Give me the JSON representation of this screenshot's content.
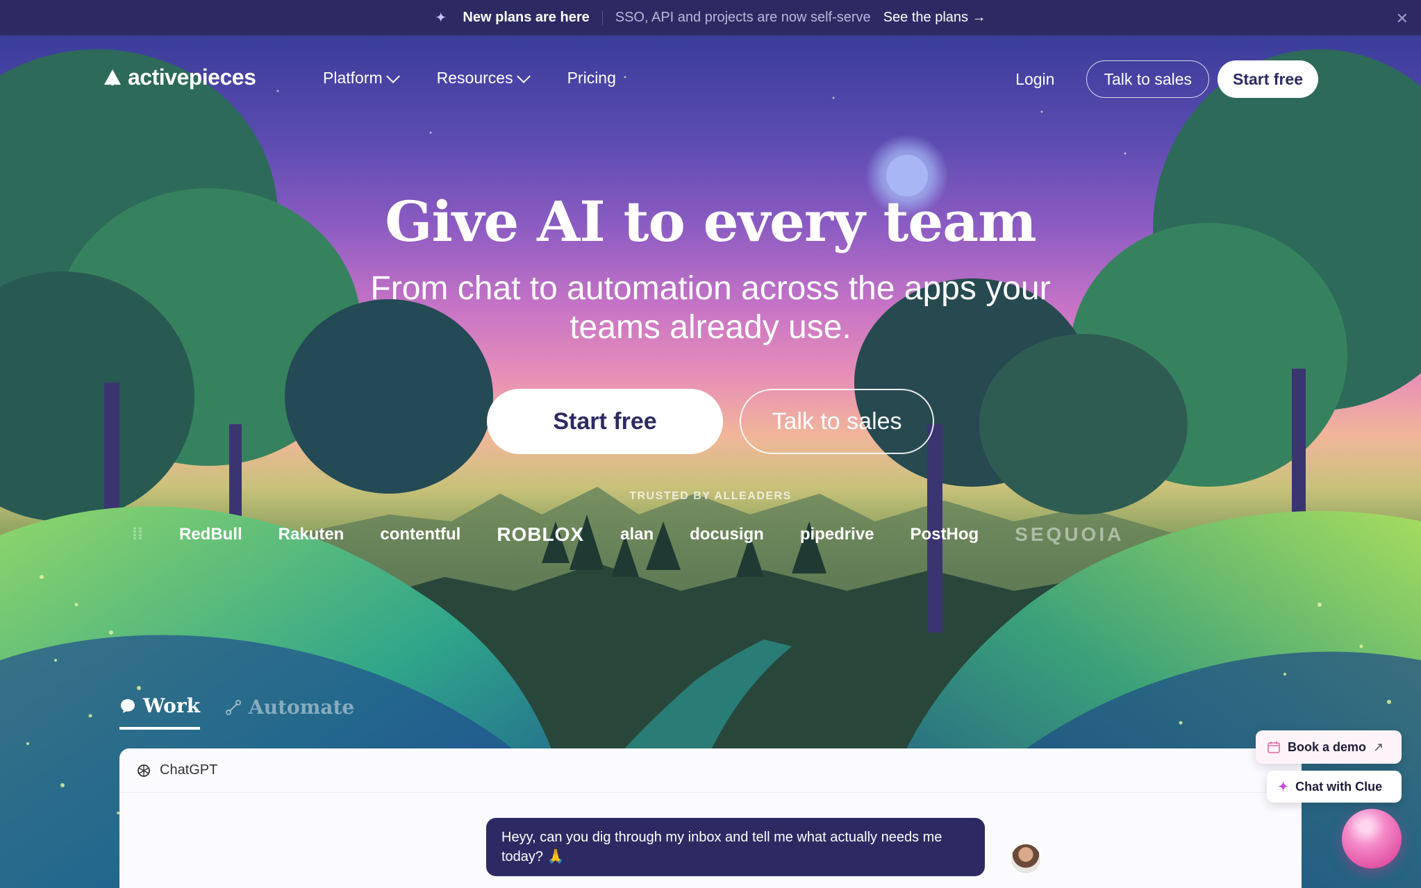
{
  "announcement": {
    "headline": "New plans are here",
    "detail": "SSO, API and projects are now self-serve",
    "link": "See the plans →",
    "close": "✕"
  },
  "nav": {
    "logo_text": "activepieces",
    "links": [
      {
        "label": "Platform"
      },
      {
        "label": "Resources"
      },
      {
        "label": "Pricing"
      }
    ],
    "login": "Login",
    "talk_to_sales": "Talk to sales",
    "start_free": "Start free"
  },
  "hero": {
    "title": "Give AI to every team",
    "subtitle": "From chat to automation across the apps your teams already use.",
    "cta_primary": "Start free",
    "cta_secondary": "Talk to sales"
  },
  "trusted": {
    "label": "TRUSTED BY ALLEADERS",
    "logos": [
      "RedBull",
      "Rakuten",
      "contentful",
      "ROBLOX",
      "alan",
      "docusign",
      "pipedrive",
      "PostHog",
      "SEQUOIA"
    ]
  },
  "tabs": [
    {
      "label": "Work",
      "icon": "chat-bubble-icon"
    },
    {
      "label": "Automate",
      "icon": "flow-icon"
    }
  ],
  "chat": {
    "app_name": "ChatGPT",
    "message": "Heyy, can you dig through my inbox and tell me what actually needs me today? 🙏"
  },
  "widgets": {
    "book_demo": "Book a demo",
    "chat_clue": "Chat with Clue"
  },
  "colors": {
    "navy": "#2d2a63",
    "announce_bg": "#2d2a63",
    "panel_bg": "#fbfaff",
    "orb_pink": "#e55aa8"
  }
}
